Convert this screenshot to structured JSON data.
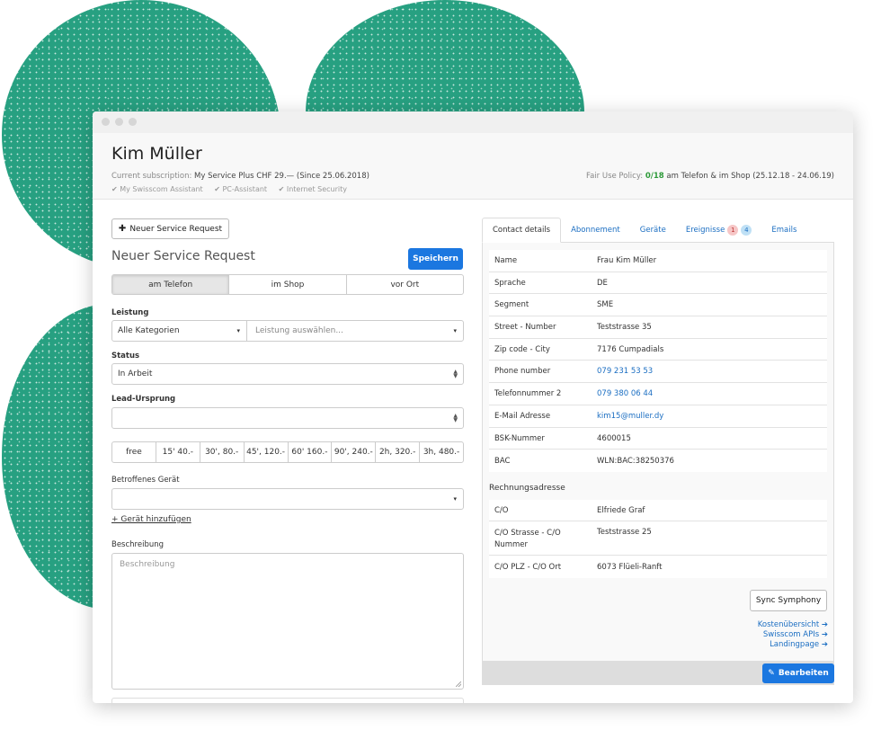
{
  "customer": {
    "name": "Kim Müller",
    "subscription_label": "Current subscription:",
    "subscription_value": "My Service Plus CHF 29.— (Since 25.06.2018)",
    "features": [
      "✔ My Swisscom Assistant",
      "✔ PC-Assistant",
      "✔ Internet Security"
    ],
    "fair_use_label": "Fair Use Policy:",
    "fair_use_count": "0/18",
    "fair_use_text": "am Telefon & im Shop",
    "fair_use_period": "(25.12.18 - 24.06.19)"
  },
  "form": {
    "new_request_button": "Neuer Service Request",
    "title": "Neuer Service Request",
    "save_button": "Speichern",
    "channels": [
      "am Telefon",
      "im Shop",
      "vor Ort"
    ],
    "active_channel": "am Telefon",
    "leistung_label": "Leistung",
    "category_value": "Alle Kategorien",
    "leistung_placeholder": "Leistung auswählen...",
    "status_label": "Status",
    "status_value": "In Arbeit",
    "lead_label": "Lead-Ursprung",
    "lead_value": "",
    "time_options": [
      "free",
      "15' 40.-",
      "30', 80.-",
      "45', 120.-",
      "60' 160.-",
      "90', 240.-",
      "2h, 320.-",
      "3h, 480.-"
    ],
    "device_label": "Betroffenes Gerät",
    "device_value": "",
    "add_device_link": "+ Gerät hinzufügen",
    "description_label": "Beschreibung",
    "description_placeholder": "Beschreibung"
  },
  "tabs": {
    "items": [
      "Contact details",
      "Abonnement",
      "Geräte",
      "Ereignisse",
      "Emails"
    ],
    "active": "Contact details",
    "ereignisse_badge_red": "1",
    "ereignisse_badge_blue": "4"
  },
  "contact": {
    "rows": [
      {
        "key": "Name",
        "value": "Frau Kim Müller"
      },
      {
        "key": "Sprache",
        "value": "DE"
      },
      {
        "key": "Segment",
        "value": "SME"
      },
      {
        "key": "Street - Number",
        "value": "Teststrasse 35"
      },
      {
        "key": "Zip code - City",
        "value": "7176 Cumpadials"
      },
      {
        "key": "Phone number",
        "value": "079 231 53 53"
      },
      {
        "key": "Telefonnummer 2",
        "value": "079 380 06 44"
      },
      {
        "key": "E-Mail Adresse",
        "value": "kim15@muller.dy"
      },
      {
        "key": "BSK-Nummer",
        "value": "4600015"
      },
      {
        "key": "BAC",
        "value": "WLN:BAC:38250376"
      }
    ],
    "billing_title": "Rechnungsadresse",
    "billing_rows": [
      {
        "key": "C/O",
        "value": "Elfriede Graf"
      },
      {
        "key": "C/O Strasse - C/O Nummer",
        "value": "Teststrasse 25"
      },
      {
        "key": "C/O PLZ - C/O Ort",
        "value": "6073 Flüeli-Ranft"
      }
    ],
    "sync_button": "Sync Symphony",
    "links": [
      "Kostenübersicht",
      "Swisscom APIs",
      "Landingpage"
    ],
    "link_arrow": "➔",
    "edit_button": "Bearbeiten"
  },
  "icons": {
    "plus": "✚",
    "pencil": "✎",
    "caret": "▾",
    "updown": "▲▼"
  },
  "colors": {
    "accent": "#1b77e0",
    "blob": "#27a081",
    "green": "#2e9a3a"
  }
}
